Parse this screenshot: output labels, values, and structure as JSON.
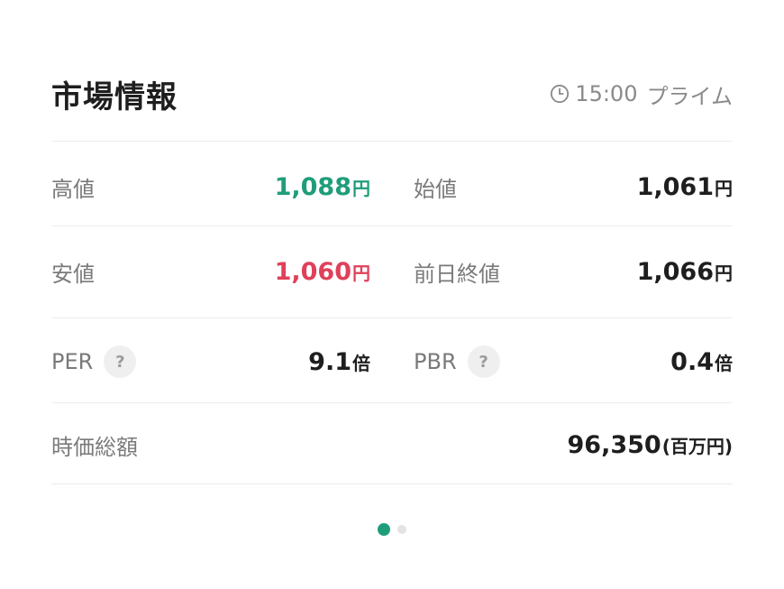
{
  "header": {
    "title": "市場情報",
    "time": "15:00",
    "market": "プライム"
  },
  "rows": [
    {
      "left": {
        "label": "高値",
        "value": "1,088",
        "unit": "円"
      },
      "right": {
        "label": "始値",
        "value": "1,061",
        "unit": "円"
      }
    },
    {
      "left": {
        "label": "安値",
        "value": "1,060",
        "unit": "円"
      },
      "right": {
        "label": "前日終値",
        "value": "1,066",
        "unit": "円"
      }
    },
    {
      "left": {
        "label": "PER",
        "help": "?",
        "value": "9.1",
        "unit": "倍"
      },
      "right": {
        "label": "PBR",
        "help": "?",
        "value": "0.4",
        "unit": "倍"
      }
    },
    {
      "full": {
        "label": "時価総額",
        "value": "96,350",
        "unit": "(百万円)"
      }
    }
  ],
  "colors": {
    "up": "#1f9d7a",
    "down": "#e0405a",
    "pager_active": "#1f9d7a"
  },
  "pager": {
    "count": 2,
    "active_index": 0
  }
}
